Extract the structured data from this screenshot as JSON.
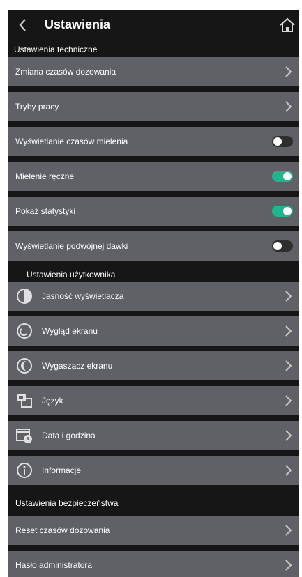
{
  "header": {
    "title": "Ustawienia",
    "back_icon": "chevron-left-icon",
    "home_icon": "home-icon"
  },
  "sections": {
    "technical": "Ustawienia techniczne",
    "user": "Ustawienia użytkownika",
    "security": "Ustawienia bezpieczeństwa"
  },
  "technical_rows": [
    {
      "label": "Zmiana czasów dozowania",
      "control": "chevron"
    },
    {
      "label": "Tryby pracy",
      "control": "chevron"
    },
    {
      "label": "Wyświetlanie czasów mielenia",
      "control": "toggle",
      "on": false
    },
    {
      "label": "Mielenie ręczne",
      "control": "toggle",
      "on": true
    },
    {
      "label": "Pokaż statystyki",
      "control": "toggle",
      "on": true
    },
    {
      "label": "Wyświetlanie podwójnej dawki",
      "control": "toggle",
      "on": false
    }
  ],
  "user_rows": [
    {
      "label": "Jasność wyświetlacza",
      "icon": "brightness-icon"
    },
    {
      "label": "Wygląd ekranu",
      "icon": "screen-appearance-icon"
    },
    {
      "label": "Wygaszacz ekranu",
      "icon": "moon-icon"
    },
    {
      "label": "Język",
      "icon": "language-icon"
    },
    {
      "label": "Data i godzina",
      "icon": "calendar-clock-icon"
    },
    {
      "label": "Informacje",
      "icon": "info-icon"
    }
  ],
  "security_rows": [
    {
      "label": "Reset czasów dozowania"
    },
    {
      "label": "Hasło administratora"
    }
  ],
  "colors": {
    "background": "#161616",
    "row": "#5f6167",
    "toggle_on": "#1fb58f",
    "toggle_off": "#2e2e2e"
  }
}
